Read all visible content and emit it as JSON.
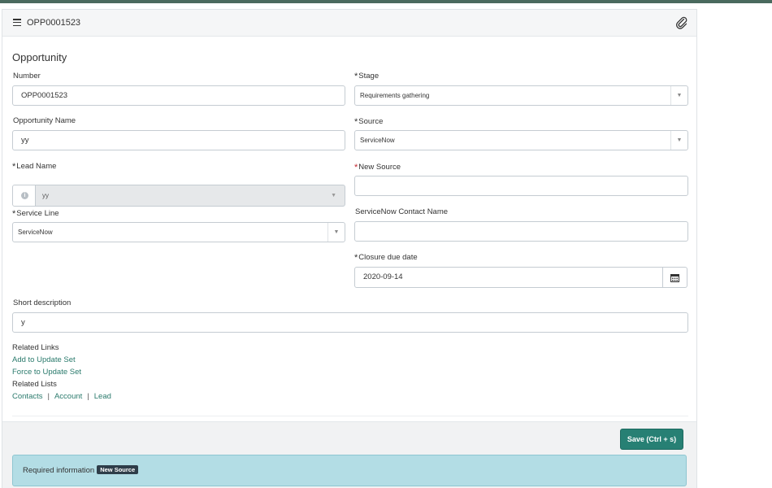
{
  "header": {
    "title": "OPP0001523"
  },
  "form": {
    "section_title": "Opportunity",
    "number": {
      "label": "Number",
      "value": "OPP0001523"
    },
    "stage": {
      "label": "Stage",
      "value": "Requirements gathering"
    },
    "opportunity_name": {
      "label": "Opportunity Name",
      "value": "yy"
    },
    "source": {
      "label": "Source",
      "value": "ServiceNow"
    },
    "lead_name": {
      "label": "Lead Name",
      "value": "yy"
    },
    "new_source": {
      "label": "New Source",
      "value": ""
    },
    "service_line": {
      "label": "Service Line",
      "value": "ServiceNow"
    },
    "servicenow_contact_name": {
      "label": "ServiceNow Contact Name",
      "value": ""
    },
    "closure_due_date": {
      "label": "Closure due date",
      "value": "2020-09-14"
    },
    "short_description": {
      "label": "Short description",
      "value": "y"
    }
  },
  "related_links": {
    "heading": "Related Links",
    "add_to_update_set": "Add to Update Set",
    "force_to_update_set": "Force to Update Set"
  },
  "related_lists": {
    "heading": "Related Lists",
    "items": [
      "Contacts",
      "Account",
      "Lead"
    ]
  },
  "footer": {
    "save_label": "Save (Ctrl + s)",
    "alert_text": "Required information",
    "alert_badge": "New Source"
  },
  "colors": {
    "accent": "#278074",
    "link": "#2a7a6c",
    "required_red": "#c1262e",
    "alert_bg": "#b3dde5"
  },
  "icons": {
    "menu": "hamburger-icon",
    "attachment": "paperclip-icon",
    "calendar": "calendar-icon",
    "info": "info-icon",
    "dropdown": "chevron-down-icon"
  }
}
